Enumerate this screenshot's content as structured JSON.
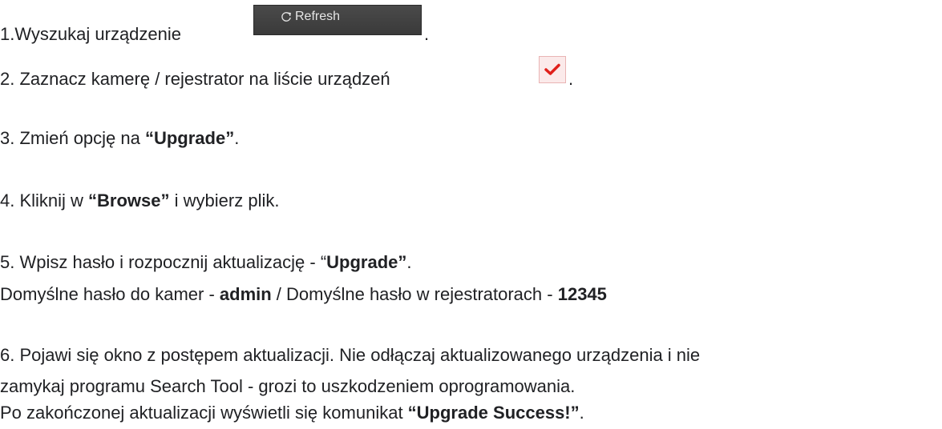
{
  "step1": {
    "text": "1.Wyszukaj urządzenie",
    "trailing": "."
  },
  "refresh_button": {
    "label": "Refresh",
    "icon": "refresh-icon",
    "background": "#3f3f3f"
  },
  "step2": {
    "text": "2. Zaznacz kamerę / rejestrator na liście urządzeń",
    "trailing": "."
  },
  "checkbox": {
    "icon": "checkmark-icon",
    "color": "#e0201b",
    "checked": true
  },
  "step3": {
    "prefix": "3. Zmień opcję na ",
    "bold": "“Upgrade”",
    "suffix": "."
  },
  "step4": {
    "prefix": "4. Kliknij w ",
    "bold": "“Browse”",
    "suffix": " i wybierz plik."
  },
  "step5": {
    "prefix": "5.  Wpisz hasło i rozpocznij aktualizację - “",
    "bold": "Upgrade”",
    "suffix": "."
  },
  "passwords": {
    "cam_prefix": "Domyślne hasło do kamer - ",
    "cam_password": "admin",
    "mid": " / Domyślne hasło w rejestratorach - ",
    "recorder_password": "12345"
  },
  "step6": {
    "line1": "6. Pojawi się okno z postępem aktualizacji. Nie odłączaj aktualizowanego urządzenia i nie",
    "line2": "zamykaj programu Search Tool - grozi to uszkodzeniem oprogramowania.",
    "line3_prefix": "Po zakończonej aktualizacji wyświetli się komunikat ",
    "line3_bold": "“Upgrade Success!”",
    "line3_suffix": "."
  }
}
